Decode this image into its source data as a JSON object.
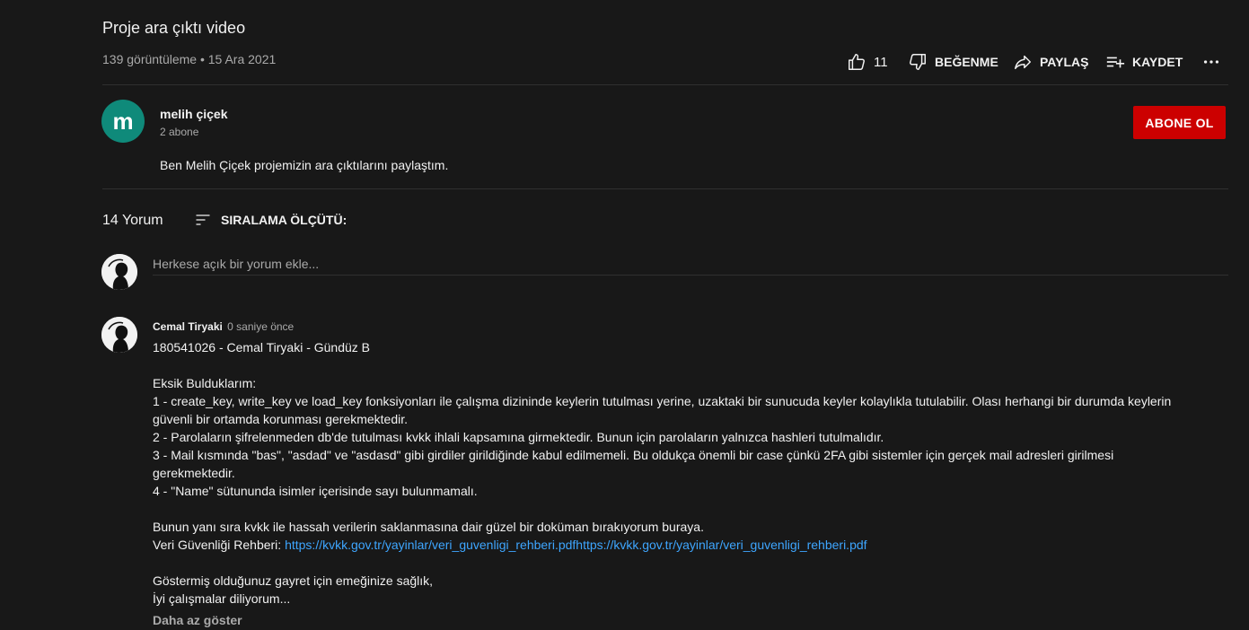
{
  "video": {
    "title": "Proje ara çıktı video",
    "meta": "139 görüntüleme • 15 Ara 2021"
  },
  "actions": {
    "like_count": "11",
    "dislike_label": "BEĞENME",
    "share_label": "PAYLAŞ",
    "save_label": "KAYDET"
  },
  "channel": {
    "avatar_letter": "m",
    "avatar_color": "#0f8a7a",
    "name": "melih çiçek",
    "subscribers": "2 abone",
    "subscribe_label": "ABONE OL",
    "description": "Ben Melih Çiçek projemizin ara çıktılarını paylaştım."
  },
  "comments_section": {
    "count_label": "14 Yorum",
    "sort_label": "SIRALAMA ÖLÇÜTÜ:",
    "input_placeholder": "Herkese açık bir yorum ekle..."
  },
  "comment": {
    "author": "Cemal Tiryaki",
    "time": "0 saniye önce",
    "lines": [
      "180541026 - Cemal Tiryaki - Gündüz B",
      "",
      "Eksik Bulduklarım:",
      "1 - create_key, write_key ve load_key fonksiyonları ile çalışma dizininde keylerin tutulması yerine, uzaktaki bir sunucuda keyler kolaylıkla tutulabilir. Olası herhangi bir durumda keylerin güvenli bir ortamda korunması gerekmektedir.",
      "2 - Parolaların şifrelenmeden db'de tutulması kvkk ihlali kapsamına girmektedir. Bunun için parolaların yalnızca hashleri tutulmalıdır.",
      "3 - Mail kısmında \"bas\", \"asdad\" ve \"asdasd\" gibi girdiler girildiğinde kabul edilmemeli. Bu oldukça önemli bir case çünkü 2FA gibi sistemler için gerçek mail adresleri girilmesi gerekmektedir.",
      "4 - \"Name\" sütununda isimler içerisinde sayı bulunmamalı.",
      "",
      "Bunun yanı sıra kvkk ile hassah verilerin saklanmasına dair güzel bir doküman bırakıyorum buraya."
    ],
    "link_prefix": "Veri Güvenliği Rehberi: ",
    "link_text": "https://kvkk.gov.tr/yayinlar/veri_guvenligi_rehberi.pdfhttps://kvkk.gov.tr/yayinlar/veri_guvenligi_rehberi.pdf",
    "closing_lines": [
      "",
      "Göstermiş olduğunuz gayret için emeğinize sağlık,",
      "İyi çalışmalar diliyorum..."
    ],
    "show_less": "Daha az göster"
  },
  "colors": {
    "background": "#181818",
    "subscribe": "#cc0000",
    "link": "#3ea6ff",
    "secondary_text": "#aaaaaa"
  }
}
